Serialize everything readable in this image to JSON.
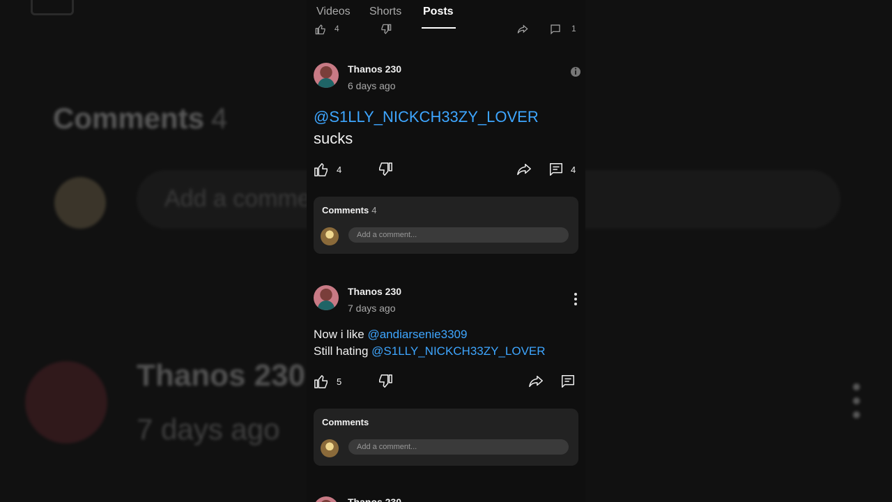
{
  "background": {
    "comments_title": "Comments",
    "comments_count": "4",
    "input_placeholder": "Add a comme",
    "author": "Thanos 230",
    "time": "7 days ago"
  },
  "tabs": [
    {
      "label": "Videos",
      "active": false
    },
    {
      "label": "Shorts",
      "active": false
    },
    {
      "label": "Posts",
      "active": true
    }
  ],
  "partial_row": {
    "like_count": "4",
    "comment_count": "1"
  },
  "posts": [
    {
      "author": "Thanos 230",
      "time": "6 days ago",
      "line1_mention": "@S1LLY_NICKCH33ZY_LOVER",
      "line2": "sucks",
      "like_count": "4",
      "comment_count": "4",
      "comments_label": "Comments",
      "comments_total": "4",
      "add_comment_placeholder": "Add a comment..."
    },
    {
      "author": "Thanos 230",
      "time": "7 days ago",
      "line1_text": "Now i like ",
      "line1_mention": "@andiarsenie3309",
      "line2_text": "Still hating ",
      "line2_mention": "@S1LLY_NICKCH33ZY_LOVER",
      "like_count": "5",
      "comments_label": "Comments",
      "add_comment_placeholder": "Add a comment..."
    }
  ],
  "next_post_author": "Thanos 230",
  "colors": {
    "background": "#0f0f0f",
    "mention": "#3ea6ff",
    "card": "#222222"
  },
  "icons": [
    "like-icon",
    "dislike-icon",
    "share-icon",
    "comment-icon",
    "more-vert-icon",
    "info-icon"
  ]
}
